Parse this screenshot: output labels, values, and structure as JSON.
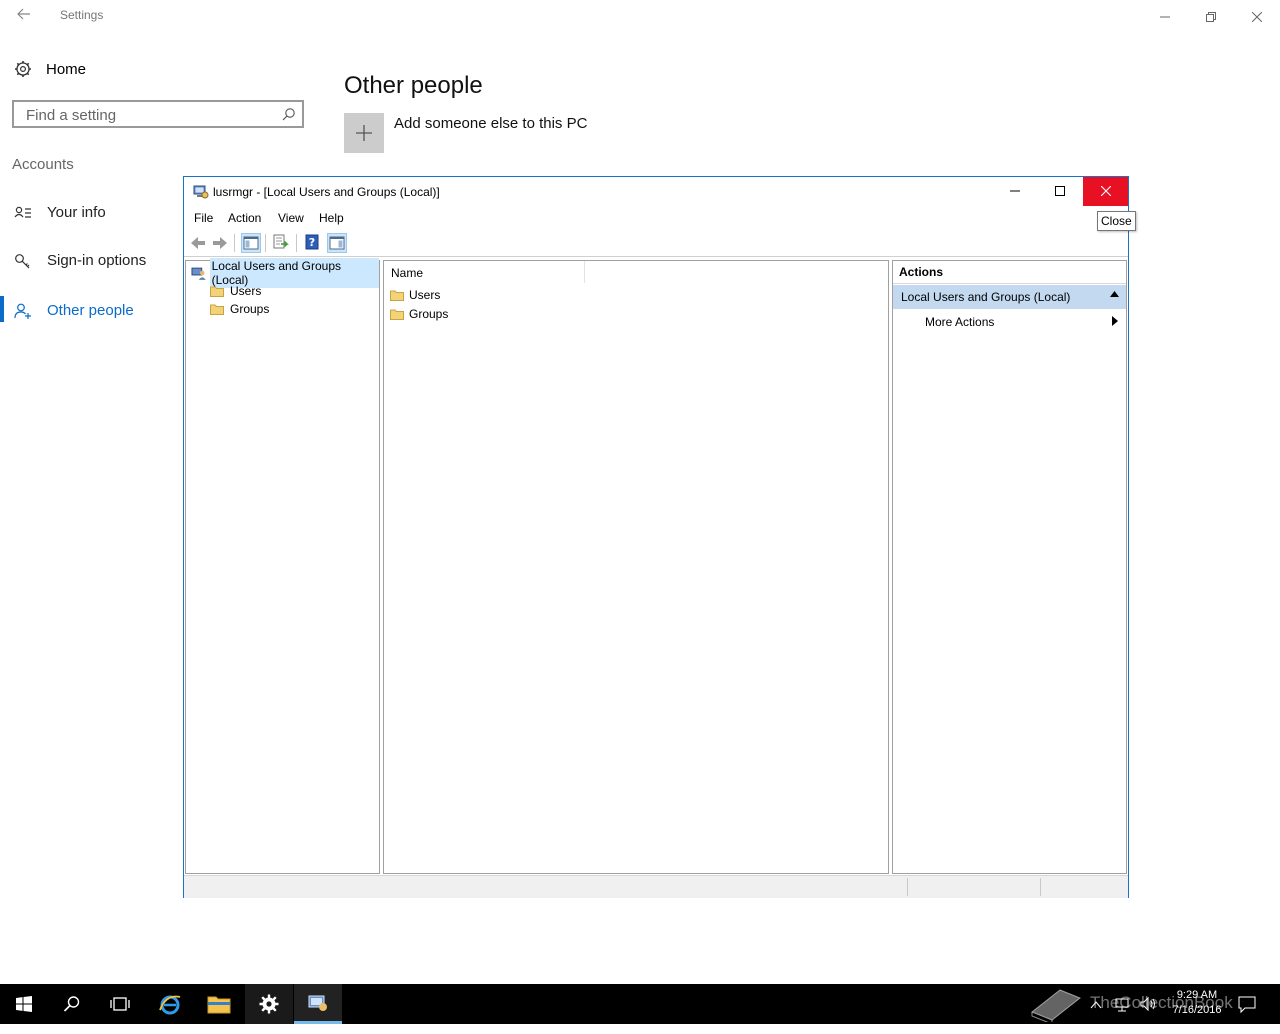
{
  "settings": {
    "window_title": "Settings",
    "home_label": "Home",
    "search_placeholder": "Find a setting",
    "section_heading": "Accounts",
    "nav": [
      {
        "label": "Your info"
      },
      {
        "label": "Sign-in options"
      },
      {
        "label": "Other people"
      }
    ],
    "page_title": "Other people",
    "add_label": "Add someone else to this PC",
    "accent": "#0a6bc9"
  },
  "mmc": {
    "title": "lusrmgr - [Local Users and Groups (Local)]",
    "menu": [
      "File",
      "Action",
      "View",
      "Help"
    ],
    "tree": {
      "root": "Local Users and Groups (Local)",
      "children": [
        "Users",
        "Groups"
      ]
    },
    "list": {
      "column": "Name",
      "items": [
        "Users",
        "Groups"
      ]
    },
    "actions": {
      "heading": "Actions",
      "group": "Local Users and Groups (Local)",
      "items": [
        "More Actions"
      ]
    },
    "close_tooltip": "Close",
    "close_color": "#e81123"
  },
  "taskbar": {
    "time": "9:29 AM",
    "date": "7/16/2016",
    "watermark": "TheCollectionBook"
  }
}
